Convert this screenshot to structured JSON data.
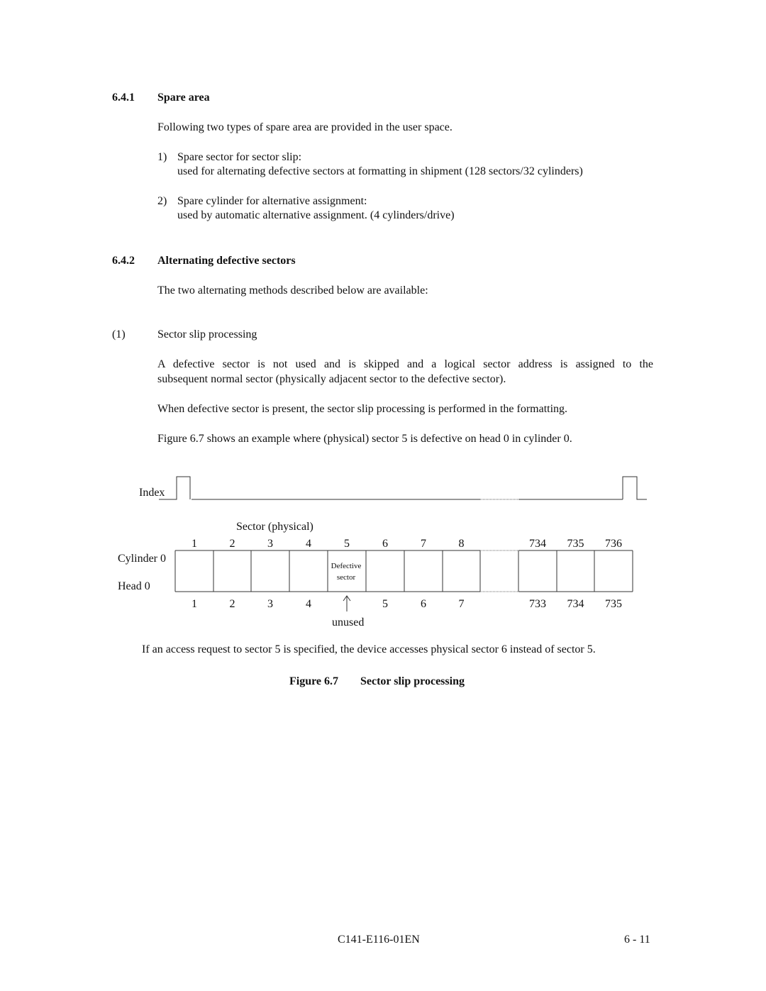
{
  "section_641": {
    "number": "6.4.1",
    "title": "Spare area",
    "intro": "Following two types of spare area are provided in the user space.",
    "items": [
      {
        "marker": "1)",
        "title": "Spare sector for sector slip:",
        "detail": "used for alternating defective sectors at formatting in shipment (128 sectors/32 cylinders)"
      },
      {
        "marker": "2)",
        "title": "Spare cylinder for alternative assignment:",
        "detail": "used by automatic alternative assignment. (4 cylinders/drive)"
      }
    ]
  },
  "section_642": {
    "number": "6.4.2",
    "title": "Alternating defective sectors",
    "intro": "The two alternating methods described below are available:",
    "method": {
      "marker": "(1)",
      "title": "Sector slip processing",
      "para1_line1": "A defective sector is not used and is skipped and a logical sector address is assigned to the",
      "para1_line2": "subsequent normal sector (physically adjacent sector to the defective sector).",
      "para2": "When defective sector is present, the sector slip processing is performed in the formatting.",
      "para3": "Figure 6.7 shows an example where (physical) sector 5 is defective on head 0 in cylinder 0."
    }
  },
  "figure": {
    "index_label": "Index",
    "sector_header": "Sector (physical)",
    "cylinder_label": "Cylinder 0",
    "head_label": "Head 0",
    "physical_numbers": [
      "1",
      "2",
      "3",
      "4",
      "5",
      "6",
      "7",
      "8",
      "734",
      "735",
      "736"
    ],
    "logical_numbers": [
      "1",
      "2",
      "3",
      "4",
      "",
      "5",
      "6",
      "7",
      "733",
      "734",
      "735"
    ],
    "defective_line1": "Defective",
    "defective_line2": "sector",
    "unused_label": "unused",
    "note": "If an access request to sector 5 is specified, the device accesses physical sector 6 instead of sector 5.",
    "caption_number": "Figure 6.7",
    "caption_title": "Sector slip processing"
  },
  "footer": {
    "doc_id": "C141-E116-01EN",
    "page": "6 - 11"
  }
}
